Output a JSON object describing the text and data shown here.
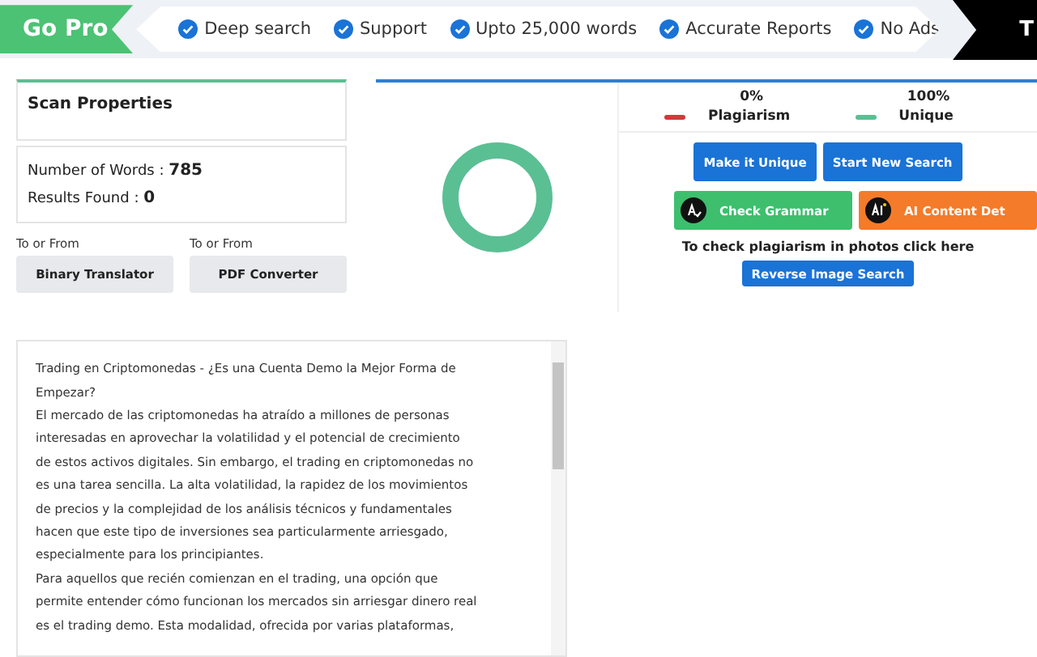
{
  "promo": {
    "badge": "Go Pro",
    "features": [
      "Deep search",
      "Support",
      "Upto 25,000 words",
      "Accurate Reports",
      "No Ads"
    ],
    "cut_button": "T"
  },
  "scan_properties": {
    "title": "Scan Properties",
    "stats": [
      {
        "label": "Number of Words : ",
        "value": "785"
      },
      {
        "label": "Results Found : ",
        "value": "0"
      }
    ]
  },
  "tools": [
    {
      "caption": "To or From",
      "button": "Binary Translator"
    },
    {
      "caption": "To or From",
      "button": "PDF Converter"
    }
  ],
  "results": {
    "legend": [
      {
        "percent": "0%",
        "label": "Plagiarism",
        "color": "#d03a3a"
      },
      {
        "percent": "100%",
        "label": "Unique",
        "color": "#5bbf94"
      }
    ],
    "actions": [
      "Make it Unique",
      "Start New Search"
    ],
    "tool_buttons": [
      {
        "label": "Check Grammar",
        "kind": "grammar"
      },
      {
        "label": "AI Content Det",
        "kind": "ai"
      }
    ],
    "photo_hint": "To check plagiarism in photos click here",
    "reverse_button": "Reverse Image Search"
  },
  "document": {
    "lines": [
      "Trading en Criptomonedas - ¿Es una Cuenta Demo la Mejor Forma de",
      "Empezar?",
      "El mercado de las criptomonedas ha atraído a millones de personas",
      "interesadas en aprovechar la volatilidad y el potencial de crecimiento",
      "de estos activos digitales. Sin embargo, el trading en criptomonedas no",
      "es una tarea sencilla. La alta volatilidad, la rapidez de los movimientos",
      "de precios y la complejidad de los análisis técnicos y fundamentales",
      "hacen que este tipo de inversiones sea particularmente arriesgado,",
      "especialmente para los principiantes.",
      "Para aquellos que recién comienzan en el trading, una opción que",
      "permite entender cómo funcionan los mercados sin arriesgar dinero real",
      "es el trading demo. Esta modalidad, ofrecida por varias plataformas,"
    ]
  }
}
